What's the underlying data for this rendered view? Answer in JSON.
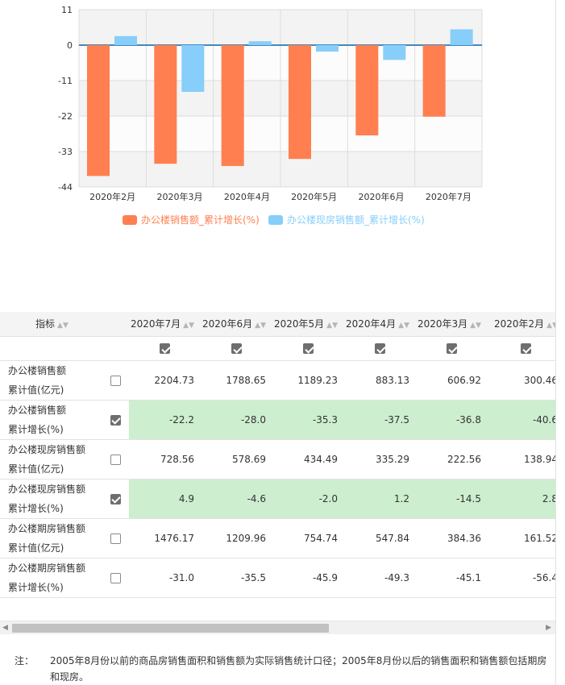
{
  "chart_data": {
    "type": "bar",
    "categories": [
      "2020年2月",
      "2020年3月",
      "2020年4月",
      "2020年5月",
      "2020年6月",
      "2020年7月"
    ],
    "series": [
      {
        "name": "办公楼销售额_累计增长(%)",
        "values": [
          -40.6,
          -36.8,
          -37.5,
          -35.3,
          -28.0,
          -22.2
        ],
        "color": "#ff7f50"
      },
      {
        "name": "办公楼现房销售额_累计增长(%)",
        "values": [
          2.8,
          -14.5,
          1.2,
          -2.0,
          -4.6,
          4.9
        ],
        "color": "#87cefa"
      }
    ],
    "yticks": [
      11,
      0,
      -11,
      -22,
      -33,
      -44
    ],
    "ylim": [
      -44,
      11
    ],
    "grid": true,
    "legend": "bottom"
  },
  "table": {
    "index_header": "指标",
    "sort_icon": "sort-icon",
    "columns": [
      "2020年7月",
      "2020年6月",
      "2020年5月",
      "2020年4月",
      "2020年3月",
      "2020年2月"
    ],
    "rows": [
      {
        "name_line1": "办公楼销售额",
        "name_line2": "累计值(亿元)",
        "checked": false,
        "values": [
          "2204.73",
          "1788.65",
          "1189.23",
          "883.13",
          "606.92",
          "300.46"
        ]
      },
      {
        "name_line1": "办公楼销售额",
        "name_line2": "累计增长(%)",
        "checked": true,
        "values": [
          "-22.2",
          "-28.0",
          "-35.3",
          "-37.5",
          "-36.8",
          "-40.6"
        ]
      },
      {
        "name_line1": "办公楼现房销售额",
        "name_line2": "累计值(亿元)",
        "checked": false,
        "values": [
          "728.56",
          "578.69",
          "434.49",
          "335.29",
          "222.56",
          "138.94"
        ]
      },
      {
        "name_line1": "办公楼现房销售额",
        "name_line2": "累计增长(%)",
        "checked": true,
        "values": [
          "4.9",
          "-4.6",
          "-2.0",
          "1.2",
          "-14.5",
          "2.8"
        ]
      },
      {
        "name_line1": "办公楼期房销售额",
        "name_line2": "累计值(亿元)",
        "checked": false,
        "values": [
          "1476.17",
          "1209.96",
          "754.74",
          "547.84",
          "384.36",
          "161.52"
        ]
      },
      {
        "name_line1": "办公楼期房销售额",
        "name_line2": "累计增长(%)",
        "checked": false,
        "values": [
          "-31.0",
          "-35.5",
          "-45.9",
          "-49.3",
          "-45.1",
          "-56.4"
        ]
      }
    ],
    "highlight_color": "#cdeecf"
  },
  "note": {
    "label": "注：",
    "text": "2005年8月份以前的商品房销售面积和销售额为实际销售统计口径；2005年8月份以后的销售面积和销售额包括期房和现房。"
  }
}
